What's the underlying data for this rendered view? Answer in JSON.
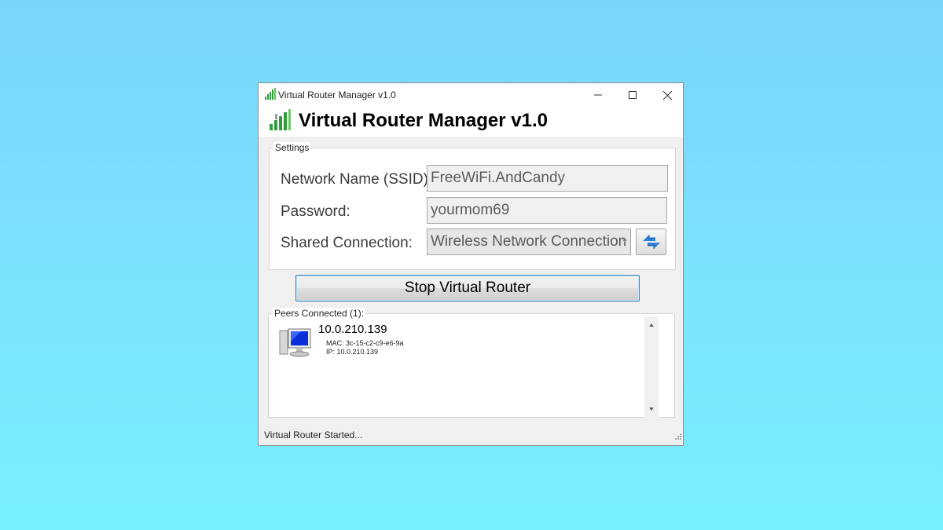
{
  "window": {
    "title": "Virtual Router Manager v1.0",
    "header_title": "Virtual Router Manager v1.0"
  },
  "settings": {
    "legend": "Settings",
    "ssid_label": "Network Name (SSID):",
    "ssid_value": "FreeWiFi.AndCandy",
    "password_label": "Password:",
    "password_value": "yourmom69",
    "shared_label": "Shared Connection:",
    "shared_value": "Wireless Network Connection"
  },
  "actions": {
    "stop_label": "Stop Virtual Router"
  },
  "peers": {
    "legend": "Peers Connected (1):",
    "items": [
      {
        "name": "10.0.210.139",
        "mac": "MAC: 3c-15-c2-c9-e6-9a",
        "ip": "IP: 10.0.210.139"
      }
    ]
  },
  "status": {
    "text": "Virtual Router Started..."
  },
  "icons": {
    "app": "signal-bars-icon",
    "refresh": "refresh-arrows-icon",
    "peer": "computer-monitor-icon"
  },
  "colors": {
    "background_top": "#7bd5fb",
    "background_bottom": "#78f0fd",
    "button_border": "#3c7fb1",
    "signal_green": "#2e9e3a"
  }
}
